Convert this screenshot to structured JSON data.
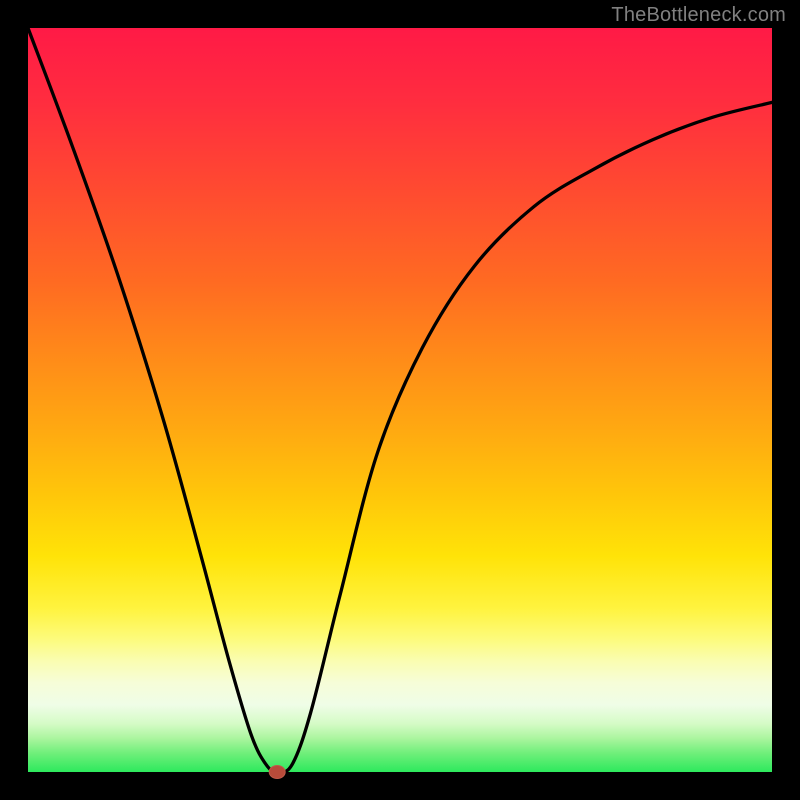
{
  "watermark": {
    "text": "TheBottleneck.com"
  },
  "chart_data": {
    "type": "line",
    "title": "",
    "xlabel": "",
    "ylabel": "",
    "xlim": [
      0,
      100
    ],
    "ylim": [
      0,
      100
    ],
    "grid": false,
    "legend": false,
    "background_gradient": {
      "direction": "vertical",
      "stops": [
        {
          "pos": 0,
          "color": "#ff1a46"
        },
        {
          "pos": 50,
          "color": "#ffb000"
        },
        {
          "pos": 80,
          "color": "#fff33f"
        },
        {
          "pos": 100,
          "color": "#2de95d"
        }
      ]
    },
    "series": [
      {
        "name": "bottleneck-curve",
        "x": [
          0,
          6,
          12,
          18,
          23,
          27,
          30,
          32,
          33.5,
          35.5,
          38,
          42,
          47,
          53,
          60,
          68,
          76,
          84,
          92,
          100
        ],
        "y": [
          100,
          84,
          67,
          48,
          30,
          15,
          5,
          1,
          0,
          1,
          8,
          24,
          43,
          57,
          68,
          76,
          81,
          85,
          88,
          90
        ]
      }
    ],
    "marker": {
      "name": "vertex",
      "x": 33.5,
      "y": 0,
      "color": "#b84b3a"
    }
  }
}
